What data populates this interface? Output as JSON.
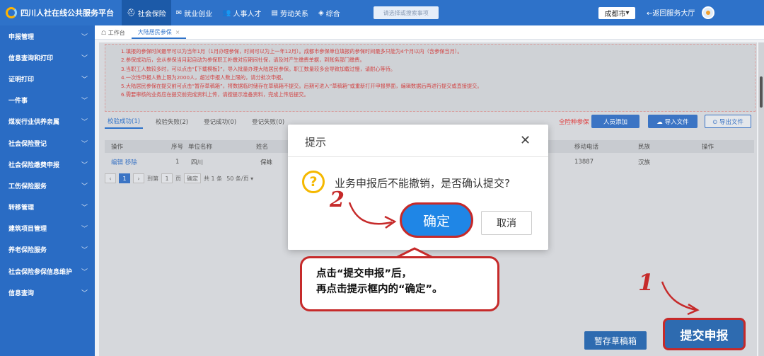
{
  "app": {
    "title": "四川人社在线公共服务平台"
  },
  "topnav": [
    {
      "icon": "handshake-icon",
      "glyph": "⛑",
      "label": "社会保险",
      "active": true
    },
    {
      "icon": "mail-icon",
      "glyph": "✉",
      "label": "就业创业"
    },
    {
      "icon": "people-icon",
      "glyph": "👥",
      "label": "人事人才"
    },
    {
      "icon": "document-icon",
      "glyph": "▤",
      "label": "劳动关系"
    },
    {
      "icon": "layers-icon",
      "glyph": "◈",
      "label": "综合"
    }
  ],
  "search": {
    "placeholder": "请选择或搜索事项"
  },
  "city": {
    "label": "成都市",
    "caret": "▾"
  },
  "back_link": {
    "label": "←返回服务大厅"
  },
  "sidebar": [
    "申报管理",
    "信息查询和打印",
    "证明打印",
    "一件事",
    "煤炭行业供养亲属",
    "社会保险登记",
    "社会保险缴费申报",
    "工伤保险服务",
    "转移管理",
    "建筑项目管理",
    "养老保险服务",
    "社会保险参保信息维护",
    "信息查询"
  ],
  "page_tabs": [
    {
      "icon": "home-icon",
      "label": "☖ 工作台"
    },
    {
      "label": "大陆居民参保",
      "close": "×",
      "active": true
    }
  ],
  "notice": [
    "1.填报的参保时间最早可以为当年1月（1月办理参保，时间可以为上一年12月）。成都市参保单位填报的参保时间最多只能为4个月以内（含参保当月）。",
    "2.参保成功后，会从参保当月起自动为参保职工补缴对应期间社保，请及时产生缴费单据，到账务部门缴费。",
    "3.当职工人数较多时，可以点击“【下载模板】”，导入批量办理大陆居民参保。职工数量较多会导致加载过慢，请耐心等待。",
    "4.一次性申报人数上限为2000人，超过申报人数上限的，请分批次申报。",
    "5.大陆居民参保在提交前可点击“暂存草稿箱”，将数据临时储存在草稿箱不提交。后期可进入“草稿箱”或重新打开申报界面，编辑数据后再进行提交或直接提交。",
    "6.需要审核的业务应在提交前完成资料上传，请按提示准备资料，完成上传后提交。"
  ],
  "subtabs": [
    {
      "label": "校验成功(1)",
      "active": true
    },
    {
      "label": "校验失败(2)"
    },
    {
      "label": "登记成功(0)"
    },
    {
      "label": "登记失败(0)"
    }
  ],
  "actions": {
    "total_label": "全险种参保",
    "add_person": "人员添加",
    "import": "☁ 导入文件",
    "export": "⊙ 导出文件"
  },
  "table": {
    "headers": [
      "操作",
      "序号",
      "单位名称",
      "姓名",
      "移动电话",
      "民族",
      "操作"
    ],
    "rows": [
      {
        "ops": "编辑 移除",
        "seq": "1",
        "unit": "四川",
        "name": "保蛛",
        "phone": "13887",
        "ethnicity": "汉族"
      }
    ]
  },
  "pager": {
    "prev": "‹",
    "current": "1",
    "next": "›",
    "goto": "到第",
    "page_input": "1",
    "page_unit": "页",
    "confirm": "确定",
    "total": "共 1 条",
    "page_size": "50 条/页 ▾"
  },
  "modal": {
    "title": "提示",
    "close": "✕",
    "icon": "?",
    "message": "业务申报后不能撤销，是否确认提交?",
    "confirm": "确定",
    "cancel": "取消"
  },
  "callout": {
    "line1": "点击“提交申报”后，",
    "line2": "再点击提示框内的“确定”。"
  },
  "steps": {
    "one": "1",
    "two": "2"
  },
  "bottom": {
    "draft": "暂存草稿箱",
    "submit": "提交申报"
  },
  "colors": {
    "header": "#2e72c9",
    "accent_red": "#c62a2a",
    "notice_red": "#d24545",
    "confirm_blue": "#1f86e6"
  }
}
